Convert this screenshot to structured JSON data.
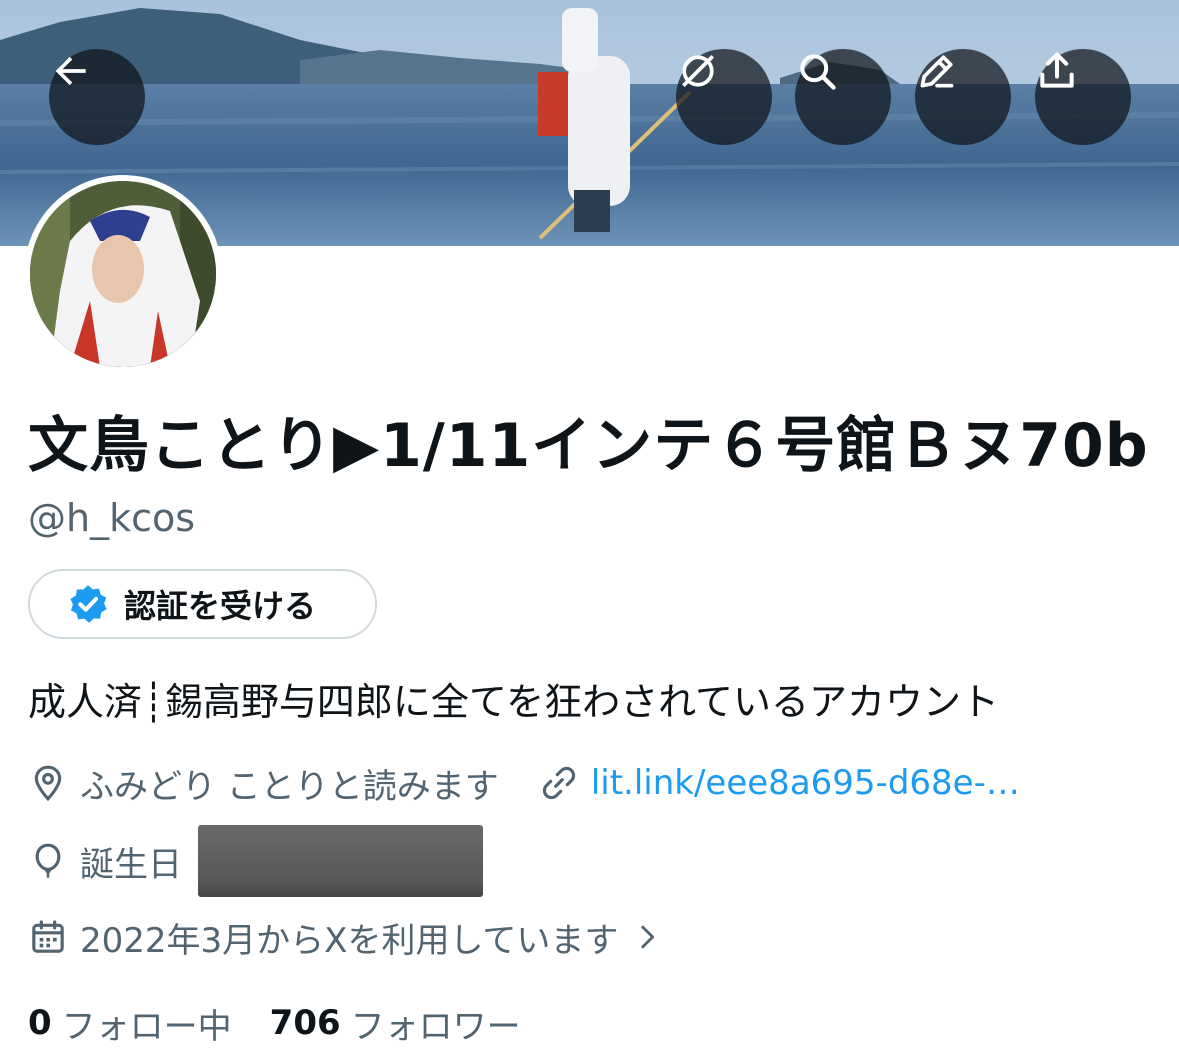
{
  "header": {
    "back_icon": "arrow-left-icon",
    "actions": [
      {
        "icon": "link-off-icon"
      },
      {
        "icon": "search-icon"
      },
      {
        "icon": "pencil-icon"
      },
      {
        "icon": "share-icon"
      }
    ]
  },
  "profile": {
    "display_name": "文鳥ことり▶1/11インテ６号館Ｂヌ70b",
    "handle": "@h_kcos",
    "verify_button_label": "認証を受ける",
    "bio": "成人済┊錫高野与四郎に全てを狂わされているアカウント",
    "location": "ふみどり ことりと読みます",
    "link": "lit.link/eee8a695-d68e-…",
    "birthday_label": "誕生日",
    "joined": "2022年3月からXを利用しています"
  },
  "stats": {
    "following_count": "0",
    "following_label": "フォロー中",
    "followers_count": "706",
    "followers_label": "フォロワー"
  },
  "colors": {
    "link": "#1d9bf0",
    "secondary_text": "#536471",
    "verified_badge": "#1d9bf0"
  }
}
